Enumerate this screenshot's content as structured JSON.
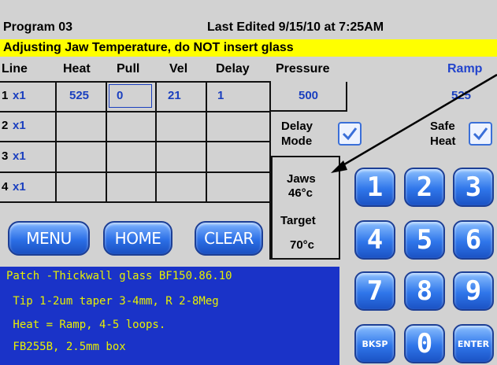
{
  "header": {
    "program": "Program 03",
    "last_edited": "Last Edited 9/15/10 at 7:25AM"
  },
  "warning": "Adjusting Jaw Temperature, do NOT insert glass",
  "columns": {
    "line": "Line",
    "heat": "Heat",
    "pull": "Pull",
    "vel": "Vel",
    "delay": "Delay",
    "pressure": "Pressure",
    "ramp": "Ramp"
  },
  "rows": [
    {
      "num": "1",
      "mult": "x1",
      "heat": "525",
      "pull": "0",
      "vel": "21",
      "delay": "1",
      "pressure": "500",
      "ramp": "525"
    },
    {
      "num": "2",
      "mult": "x1"
    },
    {
      "num": "3",
      "mult": "x1"
    },
    {
      "num": "4",
      "mult": "x1"
    }
  ],
  "delay_mode": {
    "label_line1": "Delay",
    "label_line2": "Mode",
    "checked": true
  },
  "safe_heat": {
    "label_line1": "Safe",
    "label_line2": "Heat",
    "checked": true
  },
  "jaws": {
    "label": "Jaws",
    "value": "46°c"
  },
  "target": {
    "label": "Target",
    "value": "70°c"
  },
  "buttons": {
    "menu": "MENU",
    "home": "HOME",
    "clear": "CLEAR"
  },
  "keypad": [
    "1",
    "2",
    "3",
    "4",
    "5",
    "6",
    "7",
    "8",
    "9",
    "BKSP",
    "0",
    "ENTER"
  ],
  "notes": [
    "Patch -Thickwall glass BF150.86.10",
    " Tip 1-2um taper 3-4mm, R 2-8Meg",
    " Heat = Ramp, 4-5 loops.",
    " FB255B, 2.5mm box"
  ],
  "colors": {
    "accent_blue": "#2c6fe6",
    "warning_yellow": "#ffff00",
    "notes_bg": "#1a33c8",
    "notes_text": "#e8f000"
  }
}
